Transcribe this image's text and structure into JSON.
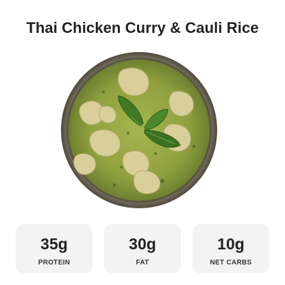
{
  "title": "Thai Chicken Curry & Cauli Rice",
  "image": {
    "subject": "thai-green-curry-bowl",
    "colors": {
      "curry": "#8fa13e",
      "bowl_rim": "#6f6a55",
      "chicken": "#d9cf9a",
      "basil": "#3f7a25"
    }
  },
  "macros": [
    {
      "value": "35g",
      "label": "PROTEIN"
    },
    {
      "value": "30g",
      "label": "FAT"
    },
    {
      "value": "10g",
      "label": "NET CARBS"
    }
  ],
  "colors": {
    "card_bg": "#f3f3f3",
    "text": "#222222"
  }
}
